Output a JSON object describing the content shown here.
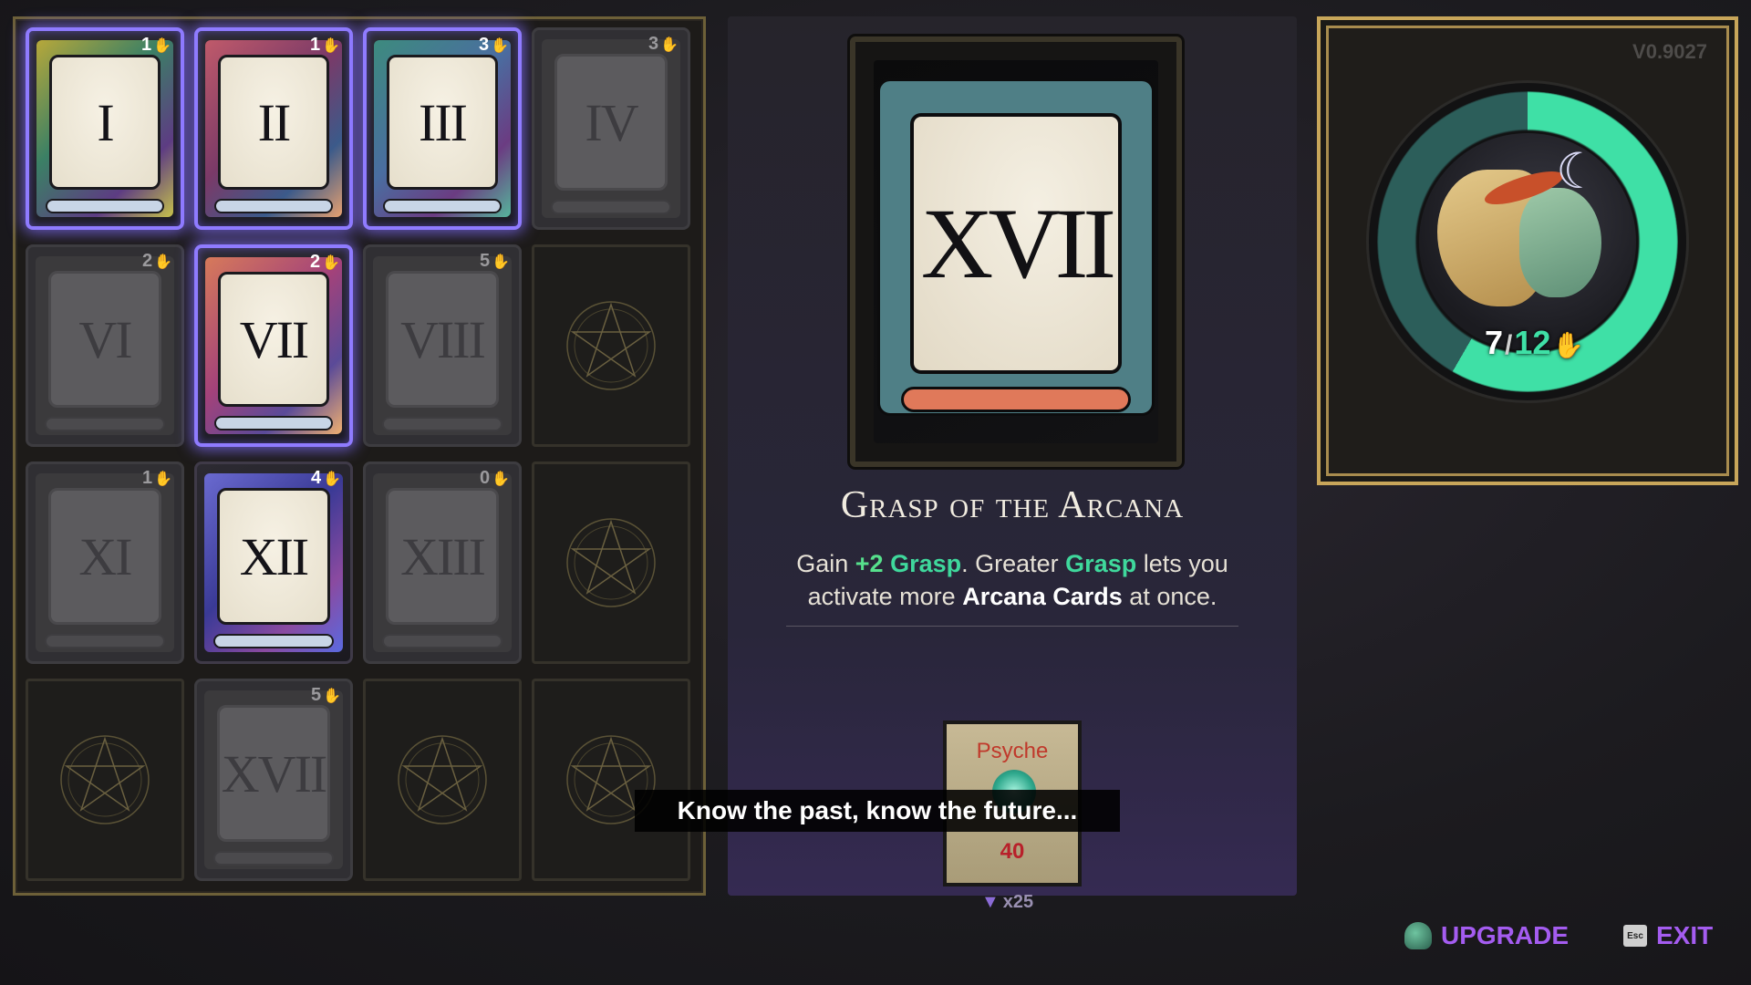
{
  "grid": {
    "cards": [
      {
        "numeral": "I",
        "cost": "1",
        "state": "active",
        "theme": "c1"
      },
      {
        "numeral": "II",
        "cost": "1",
        "state": "active",
        "theme": "c2"
      },
      {
        "numeral": "III",
        "cost": "3",
        "state": "active",
        "theme": "c3"
      },
      {
        "numeral": "IV",
        "cost": "3",
        "state": "inactive",
        "theme": ""
      },
      {
        "numeral": "VI",
        "cost": "2",
        "state": "inactive",
        "theme": ""
      },
      {
        "numeral": "VII",
        "cost": "2",
        "state": "active",
        "theme": "c7"
      },
      {
        "numeral": "VIII",
        "cost": "5",
        "state": "inactive",
        "theme": ""
      },
      {
        "numeral": "",
        "cost": "",
        "state": "empty",
        "theme": ""
      },
      {
        "numeral": "XI",
        "cost": "1",
        "state": "inactive",
        "theme": ""
      },
      {
        "numeral": "XII",
        "cost": "4",
        "state": "equipped",
        "theme": "c12"
      },
      {
        "numeral": "XIII",
        "cost": "0",
        "state": "inactive",
        "theme": ""
      },
      {
        "numeral": "",
        "cost": "",
        "state": "empty",
        "theme": ""
      },
      {
        "numeral": "",
        "cost": "",
        "state": "empty",
        "theme": ""
      },
      {
        "numeral": "XVII",
        "cost": "5",
        "state": "inactive",
        "theme": ""
      },
      {
        "numeral": "",
        "cost": "",
        "state": "empty",
        "theme": ""
      },
      {
        "numeral": "",
        "cost": "",
        "state": "empty",
        "theme": ""
      }
    ]
  },
  "selected": {
    "numeral": "XVII",
    "title": "Grasp of the Arcana",
    "desc": {
      "p1": "Gain ",
      "bonus": "+2",
      "grasp1": "Grasp",
      "p2": ". Greater ",
      "grasp2": "Grasp",
      "p3": " lets you activate more ",
      "arcana": "Arcana Cards",
      "p4": " at once."
    },
    "cost_label": "Psyche",
    "cost_value": "40",
    "stock": "x25"
  },
  "subtitle": "Know the past, know the future...",
  "portrait": {
    "version": "V0.9027",
    "grasp_current": "7",
    "grasp_sep": "/",
    "grasp_max": "12",
    "grasp_fraction": 0.583
  },
  "buttons": {
    "upgrade": "UPGRADE",
    "exit": "EXIT",
    "esc": "Esc"
  },
  "colors": {
    "active_glow": "#8f7bff",
    "grasp_green": "#3fe0a6",
    "button_purple": "#a45cf0",
    "cost_red": "#b8202a"
  }
}
